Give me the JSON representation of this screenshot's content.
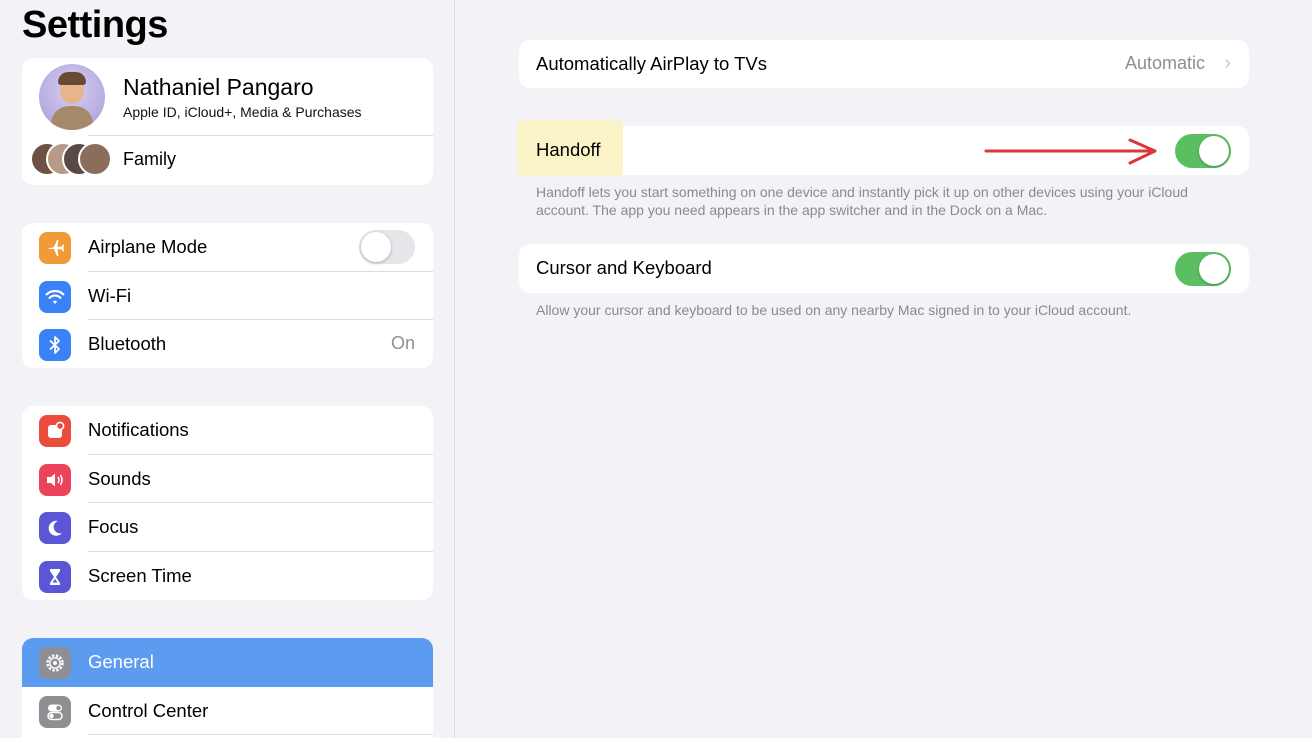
{
  "sidebar": {
    "title": "Settings",
    "profile": {
      "name": "Nathaniel Pangaro",
      "subtitle": "Apple ID, iCloud+, Media & Purchases",
      "family_label": "Family"
    },
    "group1": [
      {
        "label": "Airplane Mode",
        "icon": "airplane-icon",
        "color": "#f19a38",
        "toggle": "off"
      },
      {
        "label": "Wi-Fi",
        "icon": "wifi-icon",
        "color": "#3a82f7",
        "value": ""
      },
      {
        "label": "Bluetooth",
        "icon": "bluetooth-icon",
        "color": "#3a82f7",
        "value": "On"
      }
    ],
    "group2": [
      {
        "label": "Notifications",
        "icon": "bell-icon",
        "color": "#eb4d3d"
      },
      {
        "label": "Sounds",
        "icon": "speaker-icon",
        "color": "#eb445a"
      },
      {
        "label": "Focus",
        "icon": "moon-icon",
        "color": "#5b56d6"
      },
      {
        "label": "Screen Time",
        "icon": "hourglass-icon",
        "color": "#5b56d6"
      }
    ],
    "group3": [
      {
        "label": "General",
        "icon": "gear-icon",
        "color": "#8e8e93",
        "selected": true
      },
      {
        "label": "Control Center",
        "icon": "switches-icon",
        "color": "#8e8e93"
      }
    ]
  },
  "detail": {
    "airplay": {
      "label": "Automatically AirPlay to TVs",
      "value": "Automatic"
    },
    "handoff": {
      "label": "Handoff",
      "enabled": true,
      "footnote": "Handoff lets you start something on one device and instantly pick it up on other devices using your iCloud account. The app you need appears in the app switcher and in the Dock on a Mac."
    },
    "cursor_keyboard": {
      "label": "Cursor and Keyboard",
      "enabled": true,
      "footnote": "Allow your cursor and keyboard to be used on any nearby Mac signed in to your iCloud account."
    }
  },
  "colors": {
    "accent": "#5b9cf1",
    "toggle_on": "#5bbf62",
    "annotation_arrow": "#d9373b",
    "highlight": "#fbf2c0"
  }
}
